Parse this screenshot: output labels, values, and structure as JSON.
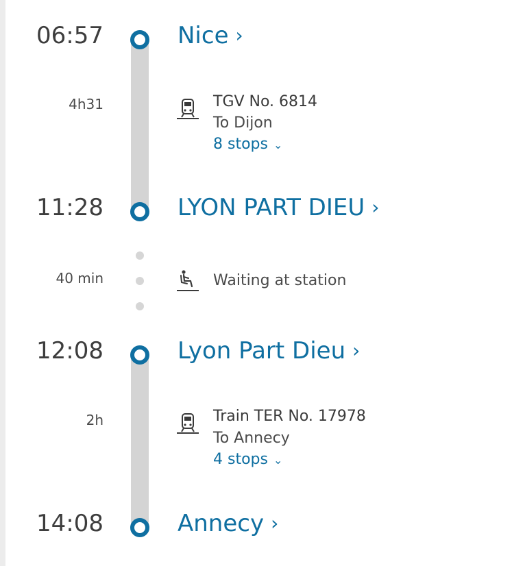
{
  "segments": [
    {
      "departure_time": "06:57",
      "departure_station": "Nice",
      "duration": "4h31",
      "train": "TGV No. 6814",
      "direction": "To Dijon",
      "stops": "8 stops",
      "arrival_time": "11:28",
      "arrival_station": "LYON PART DIEU"
    },
    {
      "departure_time": "12:08",
      "departure_station": "Lyon Part Dieu",
      "duration": "2h",
      "train": "Train TER No. 17978",
      "direction": "To Annecy",
      "stops": "4 stops",
      "arrival_time": "14:08",
      "arrival_station": "Annecy"
    }
  ],
  "connection": {
    "duration": "40 min",
    "label": "Waiting at station"
  },
  "icons": {
    "train": "train-icon",
    "waiting": "seated-person-icon",
    "station_link": "chevron-right-icon",
    "stops_toggle": "chevron-down-icon"
  },
  "colors": {
    "accent": "#0f6fa1",
    "rail": "#d4d4d4",
    "text": "#3a3a3a"
  }
}
